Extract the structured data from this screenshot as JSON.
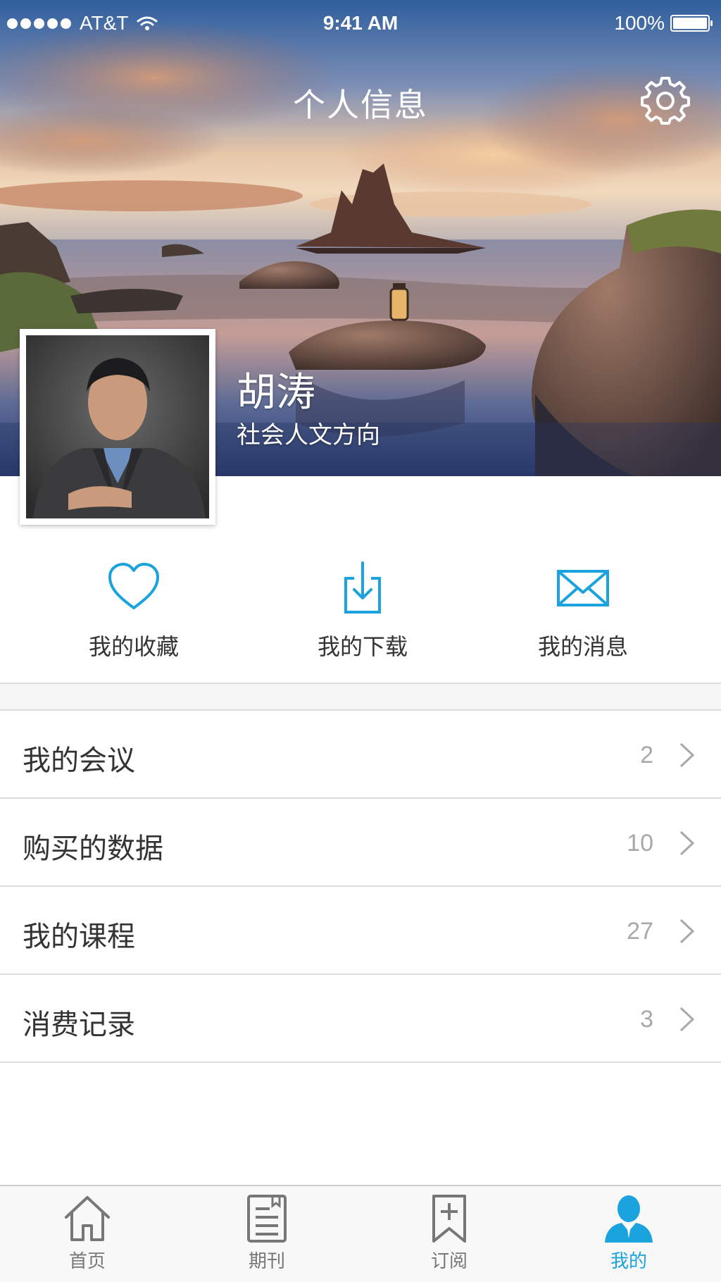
{
  "status_bar": {
    "carrier": "AT&T",
    "time": "9:41 AM",
    "battery": "100%",
    "battery_level": 1.0
  },
  "header": {
    "title": "个人信息",
    "settings_icon": "gear-icon"
  },
  "profile": {
    "name": "胡涛",
    "field": "社会人文方向"
  },
  "quick_actions": [
    {
      "label": "我的收藏",
      "icon": "heart-icon"
    },
    {
      "label": "我的下载",
      "icon": "download-icon"
    },
    {
      "label": "我的消息",
      "icon": "mail-icon"
    }
  ],
  "menu": [
    {
      "label": "我的会议",
      "count": "2"
    },
    {
      "label": "购买的数据",
      "count": "10"
    },
    {
      "label": "我的课程",
      "count": "27"
    },
    {
      "label": "消费记录",
      "count": "3"
    }
  ],
  "tabs": [
    {
      "label": "首页",
      "icon": "home-icon",
      "active": false
    },
    {
      "label": "期刊",
      "icon": "journal-icon",
      "active": false
    },
    {
      "label": "订阅",
      "icon": "bookmark-add-icon",
      "active": false
    },
    {
      "label": "我的",
      "icon": "user-icon",
      "active": true
    }
  ],
  "colors": {
    "accent": "#1aa3dc",
    "text": "#333333",
    "muted": "#a8a8a8",
    "divider": "#dcdcdc"
  }
}
